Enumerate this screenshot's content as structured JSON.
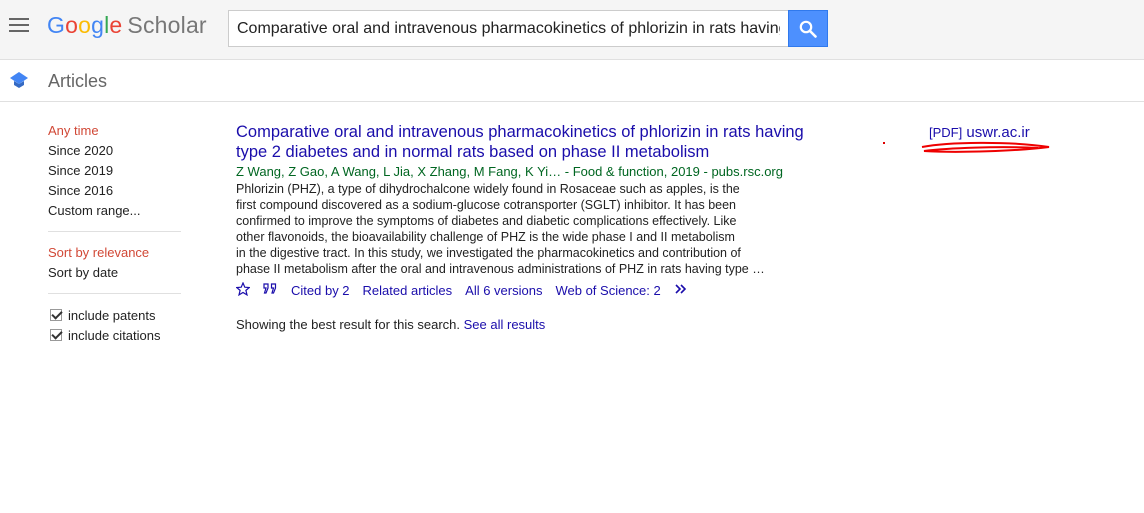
{
  "header": {
    "logo_google": "Google",
    "logo_scholar": "Scholar",
    "search_value": "Comparative oral and intravenous pharmacokinetics of phlorizin in rats having"
  },
  "subbar": {
    "label": "Articles"
  },
  "sidebar": {
    "time_filters": [
      "Any time",
      "Since 2020",
      "Since 2019",
      "Since 2016",
      "Custom range..."
    ],
    "sort_options": [
      "Sort by relevance",
      "Sort by date"
    ],
    "checkboxes": [
      "include patents",
      "include citations"
    ]
  },
  "result": {
    "title_line1": "Comparative oral and intravenous pharmacokinetics of phlorizin in rats having",
    "title_line2": "type 2 diabetes and in normal rats based on phase II metabolism",
    "authors": "Z Wang, Z Gao, A Wang, L Jia, X Zhang, M Fang, K Yi… - Food & function, 2019 - pubs.rsc.org",
    "snippet": [
      "Phlorizin (PHZ), a type of dihydrochalcone widely found in Rosaceae such as apples, is the",
      "first compound discovered as a sodium-glucose cotransporter (SGLT) inhibitor. It has been",
      "confirmed to improve the symptoms of diabetes and diabetic complications effectively. Like",
      "other flavonoids, the bioavailability challenge of PHZ is the wide phase I and II metabolism",
      "in the digestive tract. In this study, we investigated the pharmacokinetics and contribution of",
      "phase II metabolism after the oral and intravenous administrations of PHZ in rats having type …"
    ],
    "actions": {
      "cited_by": "Cited by 2",
      "related": "Related articles",
      "versions": "All 6 versions",
      "wos": "Web of Science: 2"
    }
  },
  "summary": {
    "text": "Showing the best result for this search. ",
    "link": "See all results"
  },
  "pdf": {
    "tag": "[PDF]",
    "domain": "uswr.ac.ir"
  },
  "colors": {
    "link": "#1a0dab",
    "green": "#006621",
    "active": "#d14836",
    "search_button": "#4d90fe"
  }
}
